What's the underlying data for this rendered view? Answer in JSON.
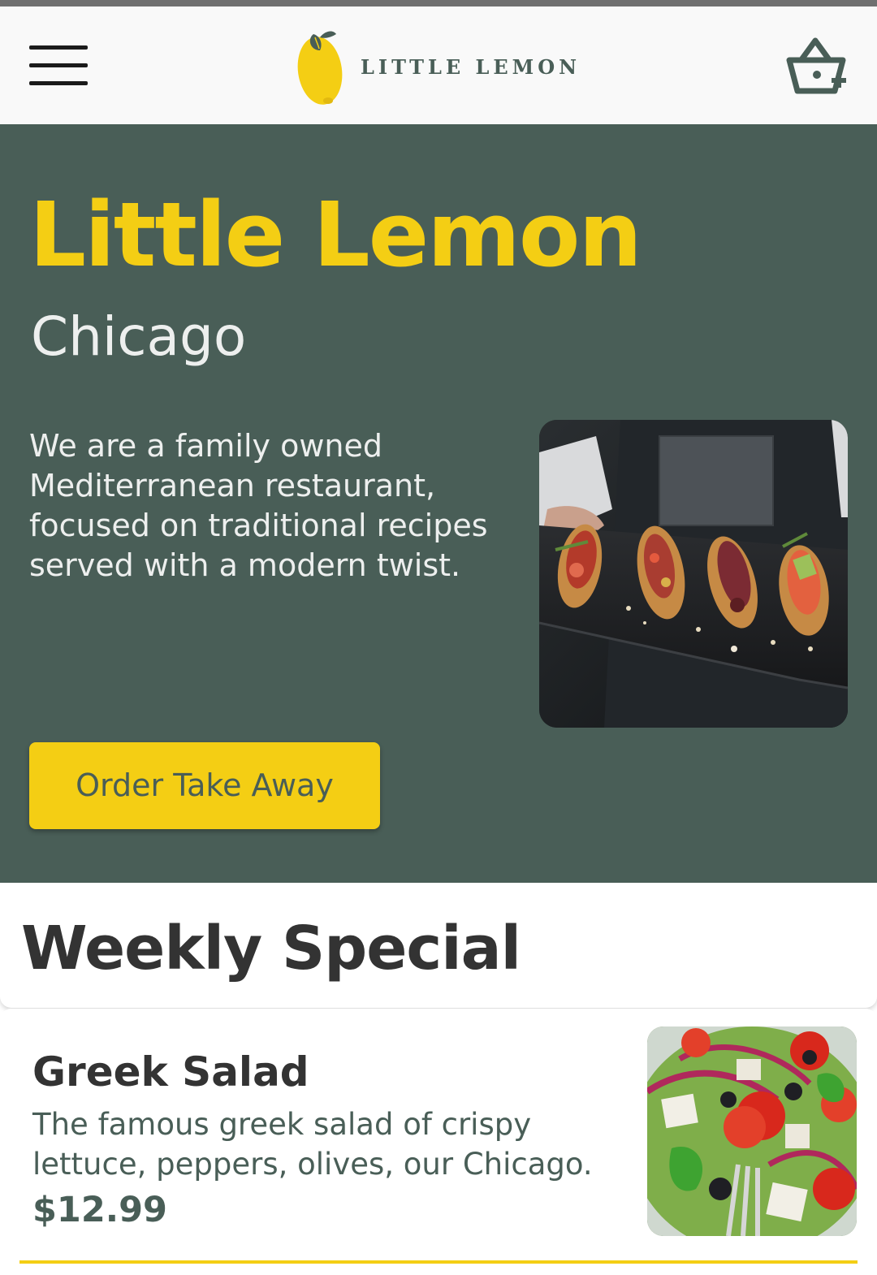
{
  "header": {
    "menu_icon": "hamburger-menu-icon",
    "logo_text": "LITTLE LEMON",
    "basket_icon": "basket-add-icon"
  },
  "hero": {
    "title": "Little Lemon",
    "city": "Chicago",
    "description": "We are a family owned Mediterranean restaurant, focused on traditional recipes served with a modern twist.",
    "order_button_label": "Order Take Away"
  },
  "weekly_special": {
    "title": "Weekly Special",
    "items": [
      {
        "name": "Greek Salad",
        "description": "The famous greek salad of crispy lettuce, peppers, olives, our Chicago.",
        "price": "$12.99"
      }
    ]
  },
  "colors": {
    "primary_green": "#495e57",
    "primary_yellow": "#f4ce14",
    "light_text": "#edefee",
    "dark_text": "#333333"
  }
}
